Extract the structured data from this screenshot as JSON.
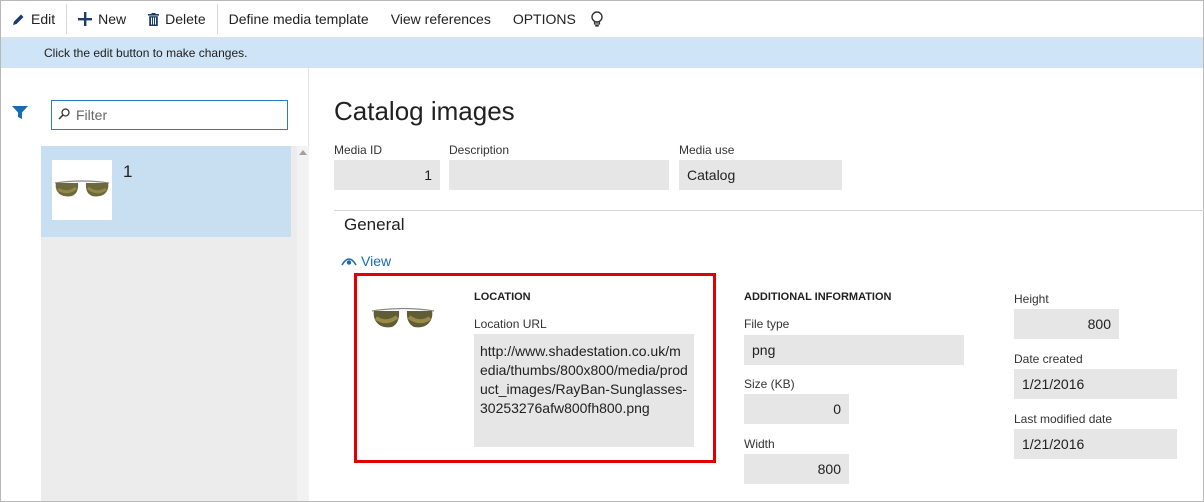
{
  "toolbar": {
    "edit_label": "Edit",
    "new_label": "New",
    "delete_label": "Delete",
    "define_template_label": "Define media template",
    "view_references_label": "View references",
    "options_label": "OPTIONS"
  },
  "infobar": {
    "message": "Click the edit button to make changes."
  },
  "left_pane": {
    "filter_placeholder": "Filter",
    "list": [
      {
        "label": "1",
        "thumbnail": "sunglasses-image"
      }
    ]
  },
  "page": {
    "title": "Catalog images",
    "media_id": {
      "label": "Media ID",
      "value": "1"
    },
    "description": {
      "label": "Description",
      "value": ""
    },
    "media_use": {
      "label": "Media use",
      "value": "Catalog"
    }
  },
  "general": {
    "title": "General",
    "view_label": "View",
    "location": {
      "heading": "LOCATION",
      "url_label": "Location URL",
      "url_value": "http://www.shadestation.co.uk/media/thumbs/800x800/media/product_images/RayBan-Sunglasses-30253276afw800fh800.png"
    },
    "additional": {
      "heading": "ADDITIONAL INFORMATION",
      "file_type": {
        "label": "File type",
        "value": "png"
      },
      "size": {
        "label": "Size (KB)",
        "value": "0"
      },
      "width": {
        "label": "Width",
        "value": "800"
      },
      "height": {
        "label": "Height",
        "value": "800"
      },
      "date_created": {
        "label": "Date created",
        "value": "1/21/2016"
      },
      "last_modified": {
        "label": "Last modified date",
        "value": "1/21/2016"
      }
    }
  },
  "colors": {
    "accent": "#1a6bb3",
    "infobar": "#cfe4f6",
    "selected_item": "#c8dff2",
    "highlight": "#e00000",
    "field_bg": "#e6e6e6"
  }
}
